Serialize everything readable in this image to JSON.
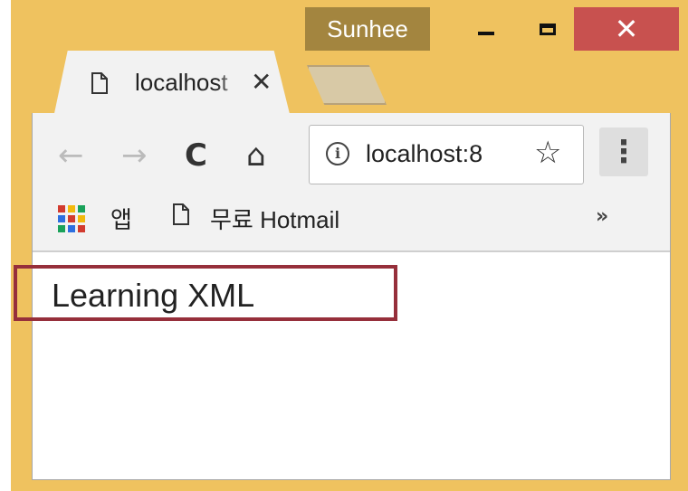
{
  "window": {
    "profile_name": "Sunhee",
    "close_symbol": "✕"
  },
  "tab": {
    "title": "localhost",
    "close_symbol": "✕",
    "icon": "file-icon"
  },
  "toolbar": {
    "back_symbol": "←",
    "forward_symbol": "→",
    "reload_symbol": "C",
    "home_symbol": "⌂",
    "url": "localhost:8",
    "star_symbol": "☆",
    "menu_symbol": "⋮"
  },
  "bookmarks": {
    "apps_label": "앱",
    "hotmail_label": "무료 Hotmail",
    "overflow_symbol": "»"
  },
  "page": {
    "text": "Learning XML"
  },
  "colors": {
    "window_frame": "#efc25f",
    "profile_bg": "#a3853f",
    "close_button": "#c8514f",
    "highlight": "#962f3b"
  }
}
